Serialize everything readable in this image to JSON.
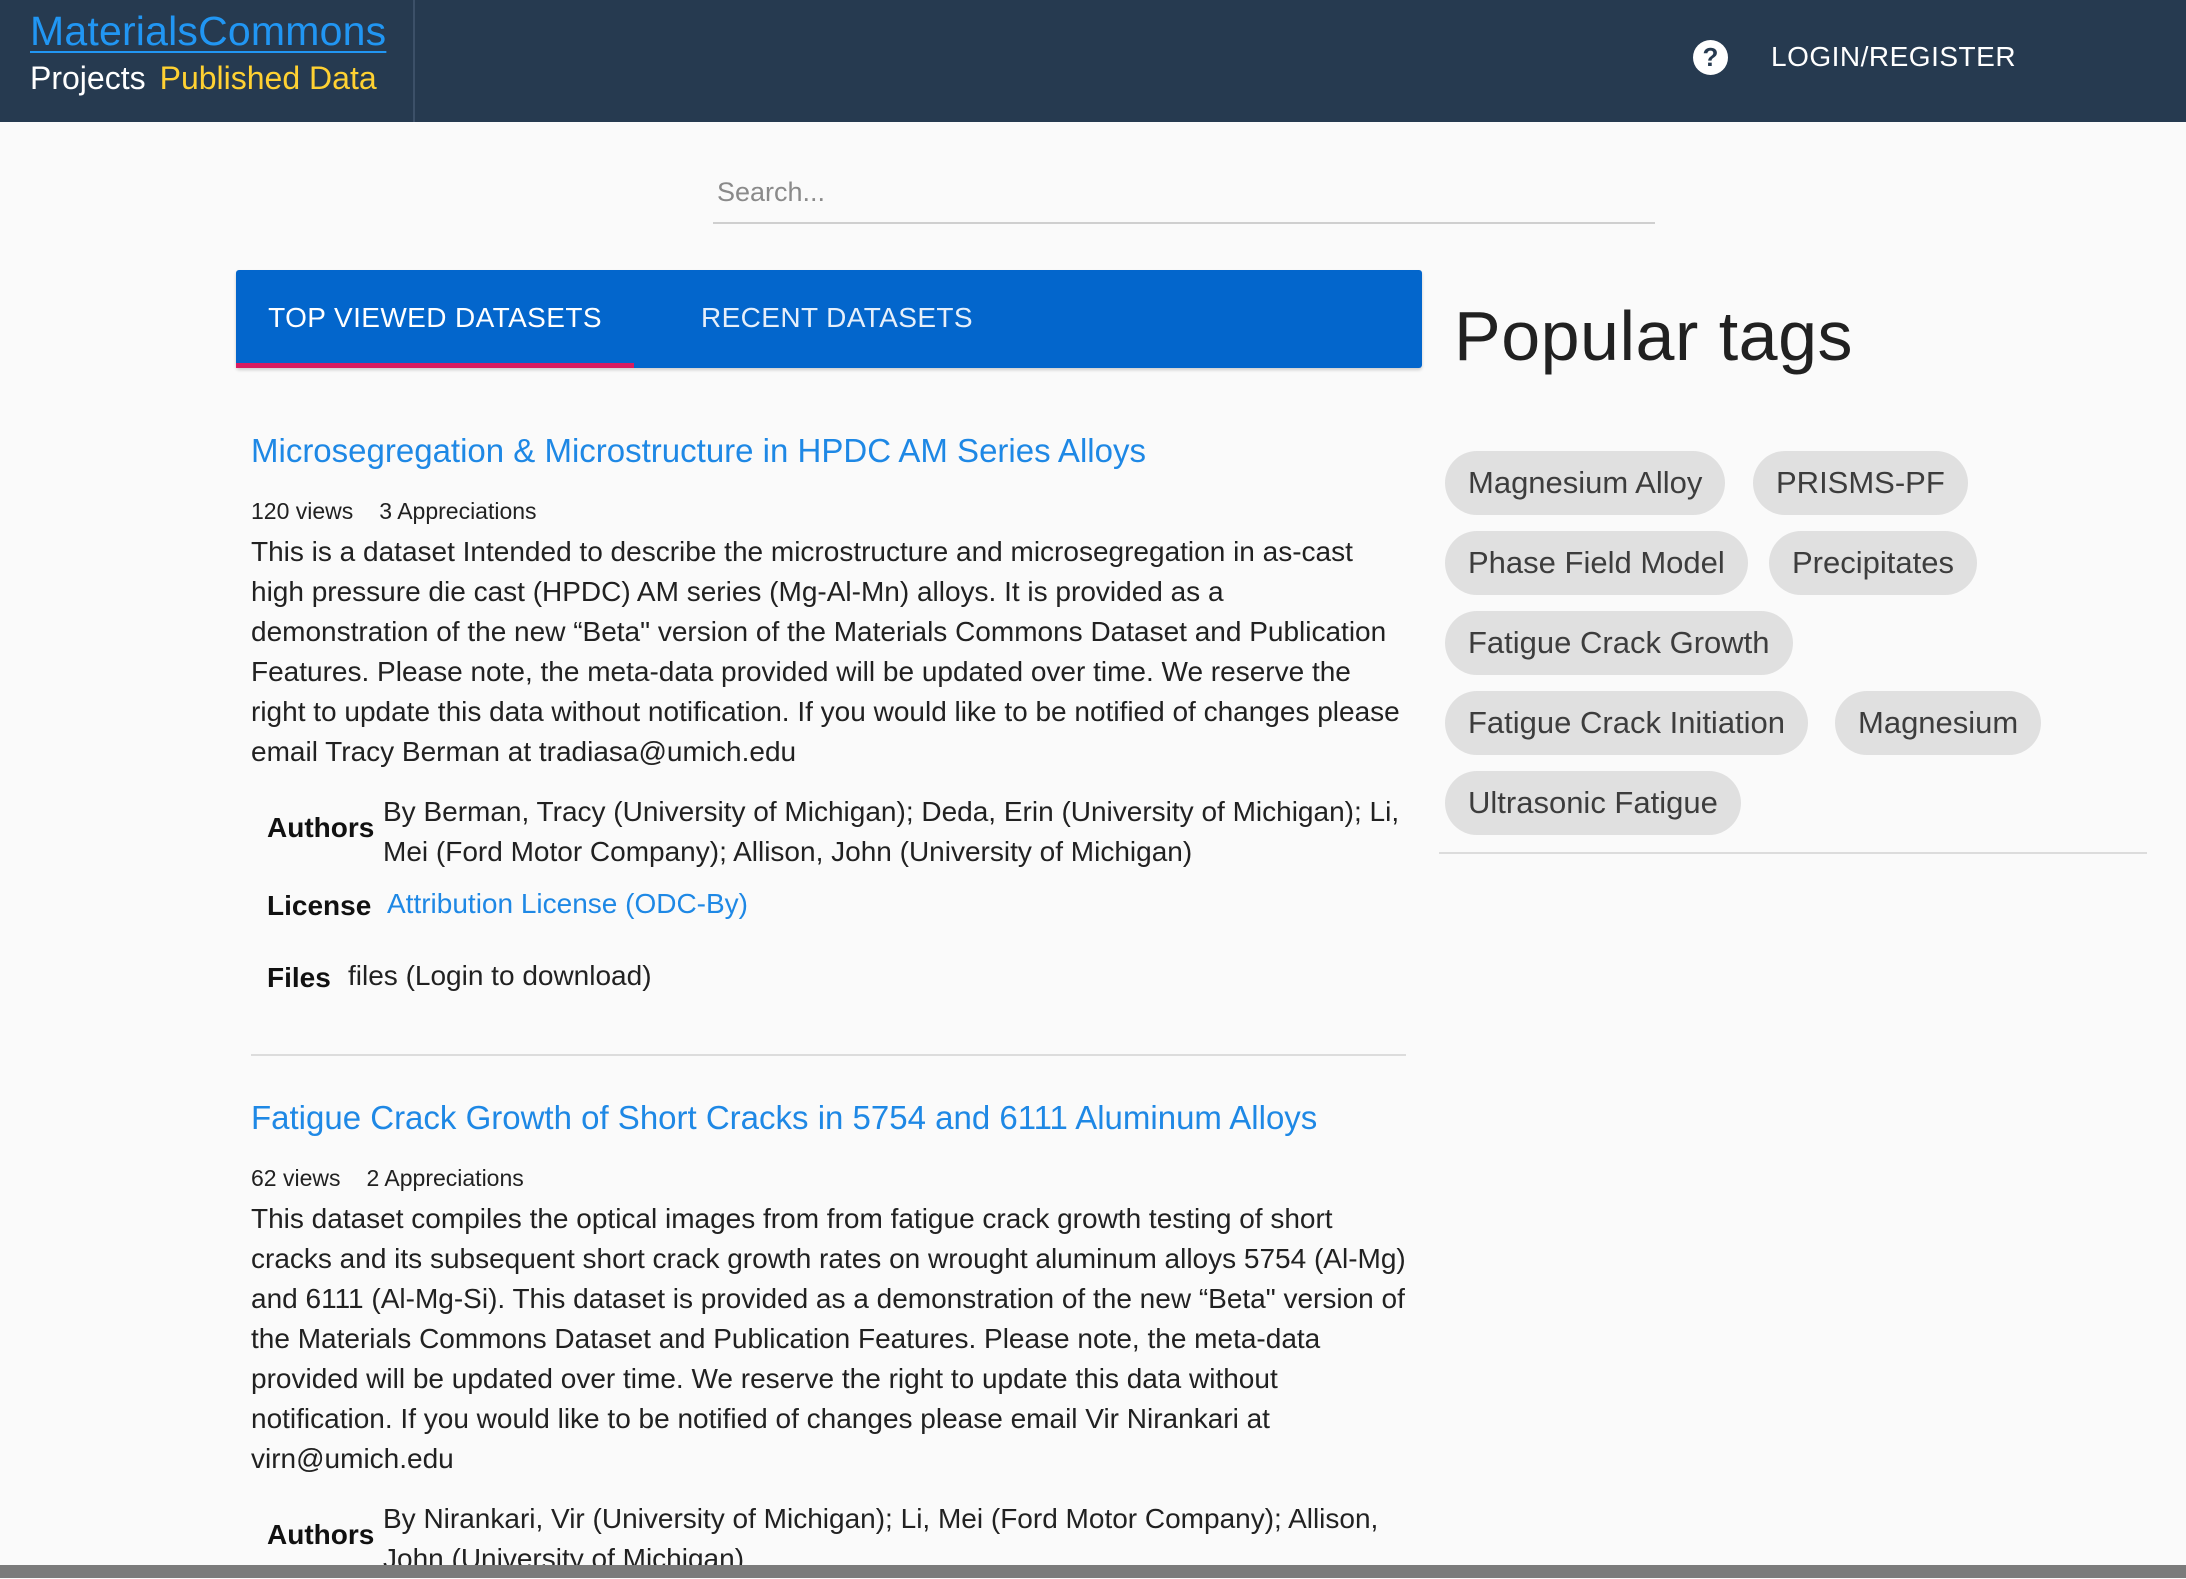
{
  "navbar": {
    "brand": "MaterialsCommons",
    "projects_label": "Projects",
    "published_label": "Published Data",
    "help_glyph": "?",
    "login_label": "LOGIN/REGISTER"
  },
  "search": {
    "placeholder": "Search...",
    "value": ""
  },
  "tabs": [
    {
      "label": "TOP VIEWED DATASETS",
      "active": true
    },
    {
      "label": "RECENT DATASETS",
      "active": false
    }
  ],
  "datasets": [
    {
      "title": "Microsegregation & Microstructure in HPDC AM Series Alloys",
      "views": "120 views",
      "appreciations": "3 Appreciations",
      "description": "This is a dataset Intended to describe the microstructure and microsegregation in as-cast high pressure die cast (HPDC) AM series (Mg-Al-Mn) alloys. It is provided as a demonstration of the new “Beta\" version of the Materials Commons Dataset and Publication Features. Please note, the meta-data provided will be updated over time. We reserve the right to update this data without notification. If you would like to be notified of changes please email Tracy Berman at tradiasa@umich.edu",
      "authors_label": "Authors",
      "authors": "By Berman, Tracy (University of Michigan); Deda, Erin (University of Michigan); Li, Mei (Ford Motor Company); Allison, John (University of Michigan)",
      "license_label": "License",
      "license": "Attribution License (ODC-By)",
      "files_label": "Files",
      "files": "files (Login to download)"
    },
    {
      "title": "Fatigue Crack Growth of Short Cracks in 5754 and 6111 Aluminum Alloys",
      "views": "62 views",
      "appreciations": "2 Appreciations",
      "description": "This dataset compiles the optical images from from fatigue crack growth testing of short cracks and its subsequent short crack growth rates on wrought aluminum alloys 5754 (Al-Mg) and 6111 (Al-Mg-Si). This dataset is provided as a demonstration of the new “Beta\" version of the Materials Commons Dataset and Publication Features. Please note, the meta-data provided will be updated over time. We reserve the right to update this data without notification. If you would like to be notified of changes please email Vir Nirankari at virn@umich.edu",
      "authors_label": "Authors",
      "authors": "By Nirankari, Vir (University of Michigan); Li, Mei (Ford Motor Company); Allison, John (University of Michigan)"
    }
  ],
  "popular_tags": {
    "heading": "Popular tags",
    "tags": [
      "Magnesium Alloy",
      "PRISMS-PF",
      "Phase Field Model",
      "Precipitates",
      "Fatigue Crack Growth",
      "Fatigue Crack Initiation",
      "Magnesium",
      "Ultrasonic Fatigue"
    ]
  },
  "colors": {
    "navbar_bg": "#263a50",
    "brand_blue": "#2196f3",
    "published_yellow": "#ffd132",
    "tab_bar_blue": "#0366cc",
    "tab_ink_pink": "#d81b60",
    "link_blue": "#1e88e5",
    "chip_bg": "#e0e0e0"
  },
  "icons": {
    "help": "help-circle-icon"
  }
}
